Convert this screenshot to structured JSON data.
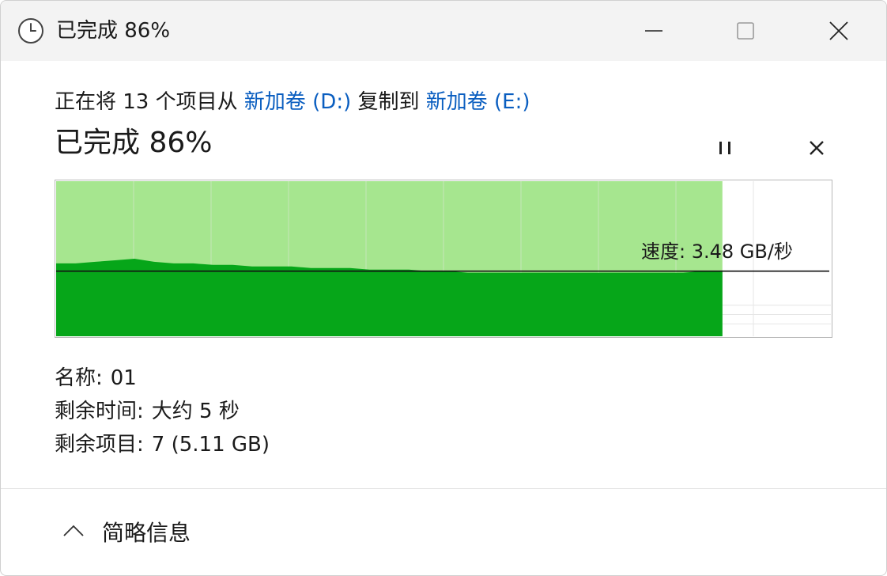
{
  "window": {
    "title": "已完成 86%",
    "icon": "clock-icon"
  },
  "titlebar": {
    "minimize_icon": "minimize-icon",
    "maximize_icon": "maximize-icon",
    "close_icon": "close-icon"
  },
  "copy": {
    "prefix": "正在将 13 个项目从 ",
    "source": "新加卷 (D:)",
    "middle": " 复制到 ",
    "destination": "新加卷 (E:)",
    "link_color": "#0a5ec0"
  },
  "progress": {
    "label": "已完成 86%",
    "percent": 86,
    "pause_icon": "pause-icon",
    "cancel_icon": "close-icon"
  },
  "chart_data": {
    "type": "area",
    "progress_fraction": 0.86,
    "speed_label": "速度: 3.48 GB/秒",
    "current_speed_fraction": 0.42,
    "speed_profile": [
      0.47,
      0.47,
      0.48,
      0.49,
      0.5,
      0.48,
      0.47,
      0.47,
      0.46,
      0.46,
      0.45,
      0.45,
      0.45,
      0.44,
      0.44,
      0.44,
      0.43,
      0.43,
      0.43,
      0.42,
      0.42,
      0.41,
      0.41,
      0.41,
      0.41,
      0.41,
      0.41,
      0.41,
      0.41,
      0.41,
      0.41,
      0.41,
      0.41,
      0.42,
      0.42
    ],
    "colors": {
      "fill_light": "#a6e68f",
      "fill_dark": "#06a619",
      "line": "#111111",
      "grid": "#c7e6b9"
    }
  },
  "details": {
    "name_label": "名称:",
    "name_value": "01",
    "time_label": "剩余时间:",
    "time_value": "大约 5 秒",
    "items_label": "剩余项目:",
    "items_value": "7 (5.11 GB)"
  },
  "footer": {
    "toggle_label": "简略信息",
    "toggle_icon": "chevron-up-icon"
  }
}
